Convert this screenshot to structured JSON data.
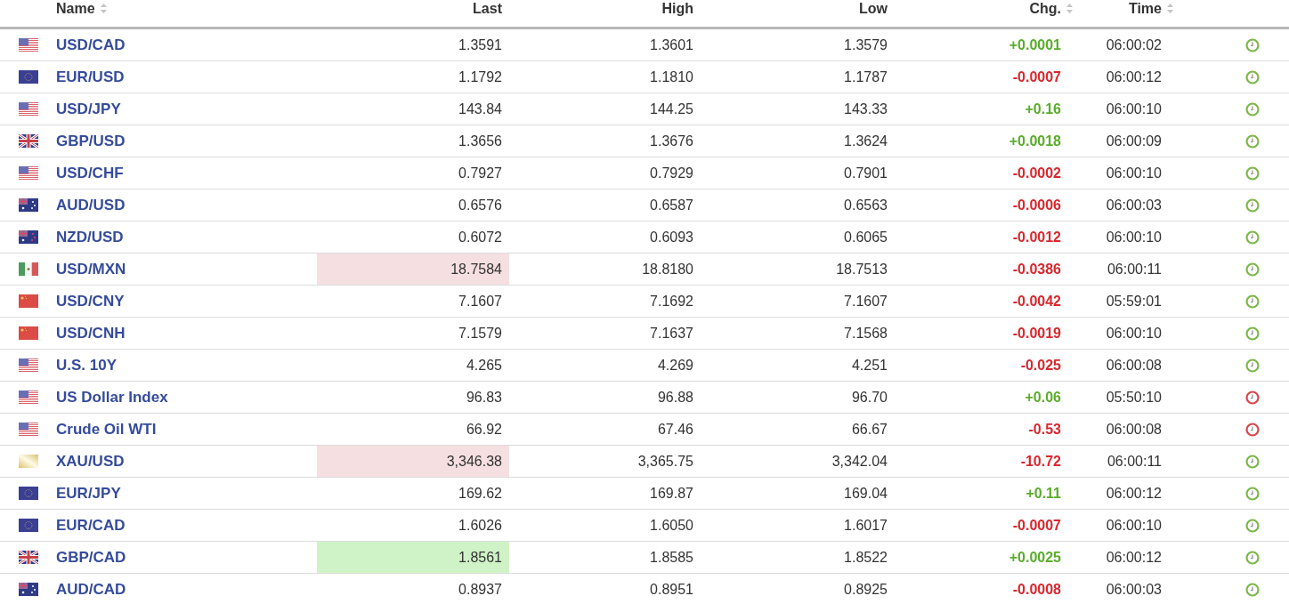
{
  "columns": [
    {
      "label": "Name",
      "sortable": true
    },
    {
      "label": "Last",
      "sortable": false
    },
    {
      "label": "High",
      "sortable": false
    },
    {
      "label": "Low",
      "sortable": false
    },
    {
      "label": "Chg.",
      "sortable": true
    },
    {
      "label": "Time",
      "sortable": true
    }
  ],
  "rows": [
    {
      "kind": "us",
      "name": "USD/CAD",
      "last": "1.3591",
      "flashed": false,
      "high": "1.3601",
      "low": "1.3579",
      "chg": "+0.0001",
      "up": true,
      "time": "06:00:02",
      "live": true
    },
    {
      "kind": "eu",
      "name": "EUR/USD",
      "last": "1.1792",
      "flashed": false,
      "high": "1.1810",
      "low": "1.1787",
      "chg": "-0.0007",
      "up": false,
      "time": "06:00:12",
      "live": true
    },
    {
      "kind": "us",
      "name": "USD/JPY",
      "last": "143.84",
      "flashed": false,
      "high": "144.25",
      "low": "143.33",
      "chg": "+0.16",
      "up": true,
      "time": "06:00:10",
      "live": true
    },
    {
      "kind": "gb",
      "name": "GBP/USD",
      "last": "1.3656",
      "flashed": false,
      "high": "1.3676",
      "low": "1.3624",
      "chg": "+0.0018",
      "up": true,
      "time": "06:00:09",
      "live": true
    },
    {
      "kind": "us",
      "name": "USD/CHF",
      "last": "0.7927",
      "flashed": false,
      "high": "0.7929",
      "low": "0.7901",
      "chg": "-0.0002",
      "up": false,
      "time": "06:00:10",
      "live": true
    },
    {
      "kind": "au",
      "name": "AUD/USD",
      "last": "0.6576",
      "flashed": false,
      "high": "0.6587",
      "low": "0.6563",
      "chg": "-0.0006",
      "up": false,
      "time": "06:00:03",
      "live": true
    },
    {
      "kind": "nz",
      "name": "NZD/USD",
      "last": "0.6072",
      "flashed": false,
      "high": "0.6093",
      "low": "0.6065",
      "chg": "-0.0012",
      "up": false,
      "time": "06:00:10",
      "live": true
    },
    {
      "kind": "mx",
      "name": "USD/MXN",
      "last": "18.7584",
      "flashed": true,
      "high": "18.8180",
      "low": "18.7513",
      "chg": "-0.0386",
      "up": false,
      "time": "06:00:11",
      "live": true
    },
    {
      "kind": "cn",
      "name": "USD/CNY",
      "last": "7.1607",
      "flashed": false,
      "high": "7.1692",
      "low": "7.1607",
      "chg": "-0.0042",
      "up": false,
      "time": "05:59:01",
      "live": true
    },
    {
      "kind": "cn",
      "name": "USD/CNH",
      "last": "7.1579",
      "flashed": false,
      "high": "7.1637",
      "low": "7.1568",
      "chg": "-0.0019",
      "up": false,
      "time": "06:00:10",
      "live": true
    },
    {
      "kind": "us",
      "name": "U.S. 10Y",
      "last": "4.265",
      "flashed": false,
      "high": "4.269",
      "low": "4.251",
      "chg": "-0.025",
      "up": false,
      "time": "06:00:08",
      "live": true
    },
    {
      "kind": "us",
      "name": "US Dollar Index",
      "last": "96.83",
      "flashed": false,
      "high": "96.88",
      "low": "96.70",
      "chg": "+0.06",
      "up": true,
      "time": "05:50:10",
      "live": false
    },
    {
      "kind": "us",
      "name": "Crude Oil WTI",
      "last": "66.92",
      "flashed": false,
      "high": "67.46",
      "low": "66.67",
      "chg": "-0.53",
      "up": false,
      "time": "06:00:08",
      "live": false
    },
    {
      "kind": "gold",
      "name": "XAU/USD",
      "last": "3,346.38",
      "flashed": true,
      "high": "3,365.75",
      "low": "3,342.04",
      "chg": "-10.72",
      "up": false,
      "time": "06:00:11",
      "live": true
    },
    {
      "kind": "eu",
      "name": "EUR/JPY",
      "last": "169.62",
      "flashed": false,
      "high": "169.87",
      "low": "169.04",
      "chg": "+0.11",
      "up": true,
      "time": "06:00:12",
      "live": true
    },
    {
      "kind": "eu",
      "name": "EUR/CAD",
      "last": "1.6026",
      "flashed": false,
      "high": "1.6050",
      "low": "1.6017",
      "chg": "-0.0007",
      "up": false,
      "time": "06:00:10",
      "live": true
    },
    {
      "kind": "gb",
      "name": "GBP/CAD",
      "last": "1.8561",
      "flashed": true,
      "high": "1.8585",
      "low": "1.8522",
      "chg": "+0.0025",
      "up": true,
      "time": "06:00:12",
      "live": true
    },
    {
      "kind": "au",
      "name": "AUD/CAD",
      "last": "0.8937",
      "flashed": false,
      "high": "0.8951",
      "low": "0.8925",
      "chg": "-0.0008",
      "up": false,
      "time": "06:00:03",
      "live": true
    }
  ]
}
